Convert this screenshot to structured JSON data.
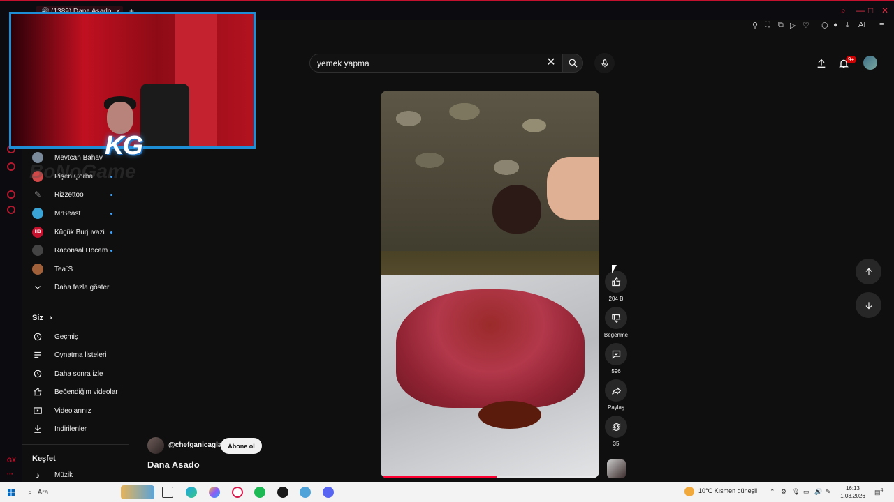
{
  "browser": {
    "tab_title": "(1389) Dana Asado",
    "close_tab": "×",
    "new_tab": "+",
    "ai_label": "AI",
    "gx_label": "GX",
    "more_label": "···"
  },
  "header": {
    "search_value": "yemek yapma",
    "clear_symbol": "✕",
    "notifications_badge": "9+"
  },
  "sidebar": {
    "subscriptions": [
      {
        "label": "Mevtcan Bahav",
        "color": "#7a8a9a",
        "dot": false
      },
      {
        "label": "Pişen Çorba",
        "color": "#d04848",
        "dot": true
      },
      {
        "label": "Rizzettoo",
        "color": "#2b2b2b",
        "dot": true
      },
      {
        "label": "MrBeast",
        "color": "#3ba4d6",
        "dot": true
      },
      {
        "label": "Küçük Burjuvazi",
        "color": "#c4122e",
        "dot": true
      },
      {
        "label": "Raconsal Hocam",
        "color": "#444444",
        "dot": true
      },
      {
        "label": "Tea`S",
        "color": "#a0603a",
        "dot": false
      }
    ],
    "show_more": "Daha fazla göster",
    "you_section": "Siz",
    "you_items": [
      "Geçmiş",
      "Oynatma listeleri",
      "Daha sonra izle",
      "Beğendiğim videolar",
      "Videolarınız",
      "İndirilenler"
    ],
    "explore_section": "Keşfet",
    "explore_items": [
      "Müzik"
    ],
    "hb_badge": "HB"
  },
  "overlay": {
    "logo_text": "KG",
    "watermark": "BoNoGame"
  },
  "short": {
    "channel": "@chefganicaglar",
    "subscribe": "Abone ol",
    "title": "Dana Asado",
    "likes": "204 B",
    "dislike_label": "Beğenme",
    "comments": "596",
    "share_label": "Paylaş",
    "remix_count": "35",
    "progress": 0.53
  },
  "taskbar": {
    "search_placeholder": "Ara",
    "weather": "10°C  Kısmen güneşli",
    "time": "16:13",
    "date": "1.03.2026",
    "notif_count": "4"
  },
  "colors": {
    "accent": "#c4122e",
    "yt_red": "#ff0033",
    "link_blue": "#3ea6ff"
  }
}
